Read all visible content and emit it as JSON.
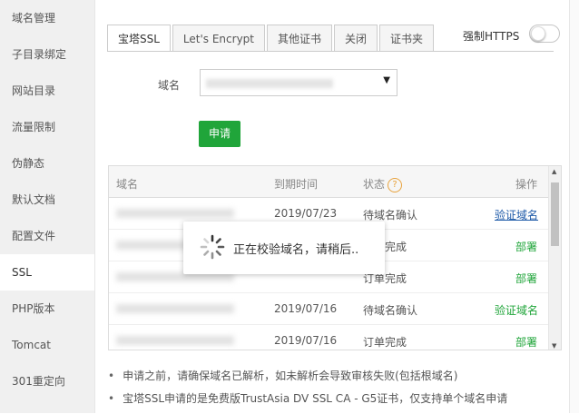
{
  "sidebar": {
    "items": [
      {
        "label": "域名管理"
      },
      {
        "label": "子目录绑定"
      },
      {
        "label": "网站目录"
      },
      {
        "label": "流量限制"
      },
      {
        "label": "伪静态"
      },
      {
        "label": "默认文档"
      },
      {
        "label": "配置文件"
      },
      {
        "label": "SSL"
      },
      {
        "label": "PHP版本"
      },
      {
        "label": "Tomcat"
      },
      {
        "label": "301重定向"
      }
    ],
    "active_index": 7
  },
  "tabs": [
    {
      "label": "宝塔SSL"
    },
    {
      "label": "Let's Encrypt"
    },
    {
      "label": "其他证书"
    },
    {
      "label": "关闭"
    },
    {
      "label": "证书夹"
    }
  ],
  "force_https": {
    "label": "强制HTTPS",
    "enabled": false
  },
  "form": {
    "domain_label": "域名",
    "apply_label": "申请"
  },
  "table": {
    "headers": {
      "domain": "域名",
      "expire": "到期时间",
      "status": "状态",
      "action": "操作"
    },
    "status_help": "?",
    "rows": [
      {
        "expire": "2019/07/23",
        "status": "待域名确认",
        "action": "验证域名",
        "action_style": "link"
      },
      {
        "expire": "",
        "status": "完成",
        "action": "部署",
        "action_style": "green"
      },
      {
        "expire": "",
        "status": "订单完成",
        "action": "部署",
        "action_style": "green"
      },
      {
        "expire": "2019/07/16",
        "status": "待域名确认",
        "action": "验证域名",
        "action_style": "green"
      },
      {
        "expire": "2019/07/16",
        "status": "订单完成",
        "action": "部署",
        "action_style": "green"
      }
    ]
  },
  "notes": [
    "申请之前，请确保域名已解析，如未解析会导致审核失败(包括根域名)",
    "宝塔SSL申请的是免费版TrustAsia DV SSL CA - G5证书，仅支持单个域名申请"
  ],
  "loading": {
    "text": "正在校验域名，请稍后.."
  },
  "colors": {
    "primary_green": "#20a53a",
    "link_blue": "#1e5aa8"
  }
}
